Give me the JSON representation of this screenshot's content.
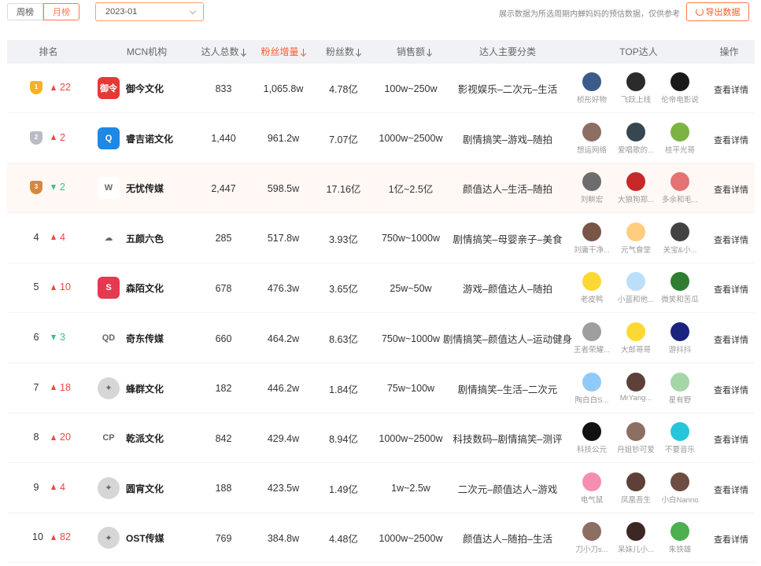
{
  "tabs": [
    {
      "label": "周榜",
      "active": false
    },
    {
      "label": "月榜",
      "active": true
    }
  ],
  "month_select": {
    "value": "2023-01"
  },
  "note": "展示数据为所选周期内蝉妈妈的预估数据，仅供参考",
  "export_label": "导出数据",
  "columns": {
    "rank": "排名",
    "mcn": "MCN机构",
    "talent_total": "达人总数",
    "fan_increase": "粉丝增量",
    "fans": "粉丝数",
    "sales": "销售额",
    "category": "达人主要分类",
    "top_talent": "TOP达人",
    "action": "操作"
  },
  "accent_color": "#ff5a2a",
  "up_color": "#f2453d",
  "down_color": "#3bbf8c",
  "rows": [
    {
      "rank": "1",
      "medal": "gold",
      "change_dir": "up",
      "change": "22",
      "logo_color": "#e53935",
      "logo_text": "御令",
      "mcn": "御今文化",
      "talent_total": "833",
      "fan_increase": "1,065.8w",
      "fans": "4.78亿",
      "sales": "100w~250w",
      "category": "影视娱乐–二次元–生活",
      "talents": [
        {
          "name": "桢彤好物",
          "color": "#3b5b8a"
        },
        {
          "name": "飞跃上线",
          "color": "#2b2b2b"
        },
        {
          "name": "伦帝电影说",
          "color": "#1a1a1a"
        }
      ]
    },
    {
      "rank": "2",
      "medal": "silver",
      "change_dir": "up",
      "change": "2",
      "logo_color": "#1e88e5",
      "logo_text": "Q",
      "mcn": "睿吉诺文化",
      "talent_total": "1,440",
      "fan_increase": "961.2w",
      "fans": "7.07亿",
      "sales": "1000w~2500w",
      "category": "剧情搞笑–游戏–随拍",
      "talents": [
        {
          "name": "想运网络",
          "color": "#8d6e63"
        },
        {
          "name": "爱唱歌的...",
          "color": "#37474f"
        },
        {
          "name": "桂平光哥",
          "color": "#7cb342"
        }
      ]
    },
    {
      "rank": "3",
      "medal": "bronze",
      "change_dir": "down",
      "change": "2",
      "logo_color": "#ffffff",
      "logo_text": "W",
      "mcn": "无忧传媒",
      "talent_total": "2,447",
      "fan_increase": "598.5w",
      "fans": "17.16亿",
      "sales": "1亿~2.5亿",
      "category": "颜值达人–生活–随拍",
      "talents": [
        {
          "name": "刘畊宏",
          "color": "#6d6d6d"
        },
        {
          "name": "大狼狗郑...",
          "color": "#c62828"
        },
        {
          "name": "多余和毛...",
          "color": "#e57373"
        }
      ]
    },
    {
      "rank": "4",
      "medal": "",
      "change_dir": "up",
      "change": "4",
      "logo_color": "#ffffff",
      "logo_text": "☁",
      "mcn": "五颜六色",
      "talent_total": "285",
      "fan_increase": "517.8w",
      "fans": "3.93亿",
      "sales": "750w~1000w",
      "category": "剧情搞笑–母婴亲子–美食",
      "talents": [
        {
          "name": "刘庸干净...",
          "color": "#795548"
        },
        {
          "name": "元气食堂",
          "color": "#ffcc80"
        },
        {
          "name": "关宝&小...",
          "color": "#424242"
        }
      ]
    },
    {
      "rank": "5",
      "medal": "",
      "change_dir": "up",
      "change": "10",
      "logo_color": "#e53950",
      "logo_text": "S",
      "mcn": "森陌文化",
      "talent_total": "678",
      "fan_increase": "476.3w",
      "fans": "3.65亿",
      "sales": "25w~50w",
      "category": "游戏–颜值达人–随拍",
      "talents": [
        {
          "name": "老皮鸭",
          "color": "#fdd835"
        },
        {
          "name": "小蓝和他...",
          "color": "#bbdefb"
        },
        {
          "name": "微笑和苦瓜",
          "color": "#2e7d32"
        }
      ]
    },
    {
      "rank": "6",
      "medal": "",
      "change_dir": "down",
      "change": "3",
      "logo_color": "#ffffff",
      "logo_text": "QD",
      "mcn": "奇东传媒",
      "talent_total": "660",
      "fan_increase": "464.2w",
      "fans": "8.63亿",
      "sales": "750w~1000w",
      "category": "剧情搞笑–颜值达人–运动健身",
      "talents": [
        {
          "name": "王者荣耀...",
          "color": "#9e9e9e"
        },
        {
          "name": "大郎哥哥",
          "color": "#fdd835"
        },
        {
          "name": "游抖抖",
          "color": "#1a237e"
        }
      ]
    },
    {
      "rank": "7",
      "medal": "",
      "change_dir": "up",
      "change": "18",
      "logo_color": "#d6d6d6",
      "logo_text": "✦",
      "mcn": "蜂群文化",
      "talent_total": "182",
      "fan_increase": "446.2w",
      "fans": "1.84亿",
      "sales": "75w~100w",
      "category": "剧情搞笑–生活–二次元",
      "talents": [
        {
          "name": "陶白白S...",
          "color": "#90caf9"
        },
        {
          "name": "MrYang...",
          "color": "#5d4037"
        },
        {
          "name": "星有野",
          "color": "#a5d6a7"
        }
      ]
    },
    {
      "rank": "8",
      "medal": "",
      "change_dir": "up",
      "change": "20",
      "logo_color": "#ffffff",
      "logo_text": "CP",
      "mcn": "乾派文化",
      "talent_total": "842",
      "fan_increase": "429.4w",
      "fans": "8.94亿",
      "sales": "1000w~2500w",
      "category": "科技数码–剧情搞笑–测评",
      "talents": [
        {
          "name": "科技公元",
          "color": "#111111"
        },
        {
          "name": "丹姐钞可爱",
          "color": "#8d6e63"
        },
        {
          "name": "不要音乐",
          "color": "#26c6da"
        }
      ]
    },
    {
      "rank": "9",
      "medal": "",
      "change_dir": "up",
      "change": "4",
      "logo_color": "#d6d6d6",
      "logo_text": "✦",
      "mcn": "圆宵文化",
      "talent_total": "188",
      "fan_increase": "423.5w",
      "fans": "1.49亿",
      "sales": "1w~2.5w",
      "category": "二次元–颜值达人–游戏",
      "talents": [
        {
          "name": "电气鼠",
          "color": "#f48fb1"
        },
        {
          "name": "凤凰吾生",
          "color": "#5d4037"
        },
        {
          "name": "小白Nanno",
          "color": "#6d4c41"
        }
      ]
    },
    {
      "rank": "10",
      "medal": "",
      "change_dir": "up",
      "change": "82",
      "logo_color": "#d6d6d6",
      "logo_text": "✦",
      "mcn": "OST传媒",
      "talent_total": "769",
      "fan_increase": "384.8w",
      "fans": "4.48亿",
      "sales": "1000w~2500w",
      "category": "颜值达人–随拍–生活",
      "talents": [
        {
          "name": "刀小刀s...",
          "color": "#8d6e63"
        },
        {
          "name": "呆妹儿小...",
          "color": "#3e2723"
        },
        {
          "name": "朱铁雄",
          "color": "#4caf50"
        }
      ]
    }
  ],
  "detail_label": "查看详情"
}
